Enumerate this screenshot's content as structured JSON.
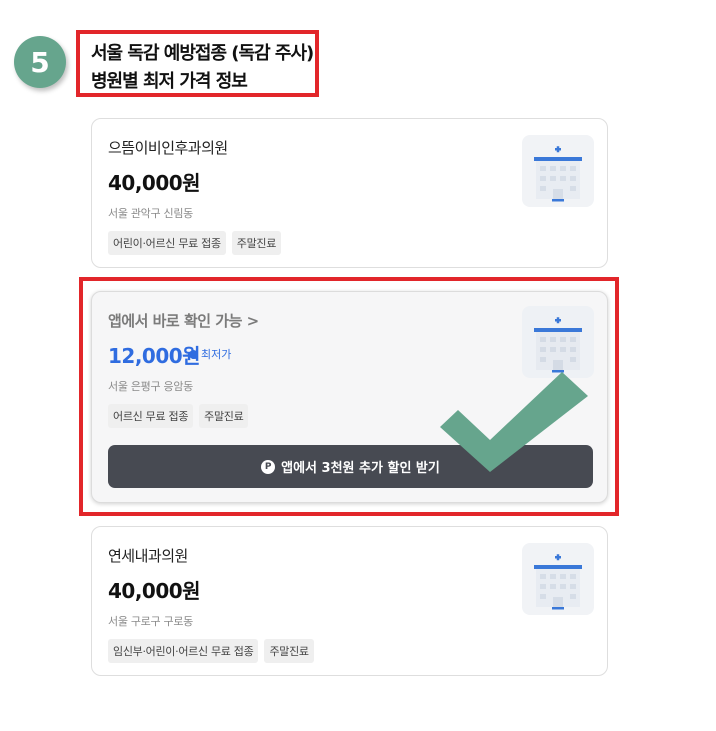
{
  "step": {
    "number": "5"
  },
  "title": {
    "line1": "서울 독감 예방접종 (독감 주사)",
    "line2": "병원별 최저 가격 정보"
  },
  "cards": [
    {
      "name": "으뜸이비인후과의원",
      "price": "40,000원",
      "address": "서울 관악구 신림동",
      "tags": [
        "어린이·어르신 무료 접종",
        "주말진료"
      ]
    },
    {
      "name": "앱에서 바로 확인 가능 >",
      "price": "12,000원",
      "badge": "최저가",
      "address": "서울 은평구 응암동",
      "tags": [
        "어르신 무료 접종",
        "주말진료"
      ],
      "button": "앱에서 3천원 추가 할인 받기",
      "button_icon": "P"
    },
    {
      "name": "연세내과의원",
      "price": "40,000원",
      "address": "서울 구로구 구로동",
      "tags": [
        "임신부·어린이·어르신 무료 접종",
        "주말진료"
      ]
    }
  ],
  "colors": {
    "accent_red": "#e2262a",
    "step_green": "#66a58d",
    "price_blue": "#2f6ce0",
    "button_dark": "#474a52"
  }
}
